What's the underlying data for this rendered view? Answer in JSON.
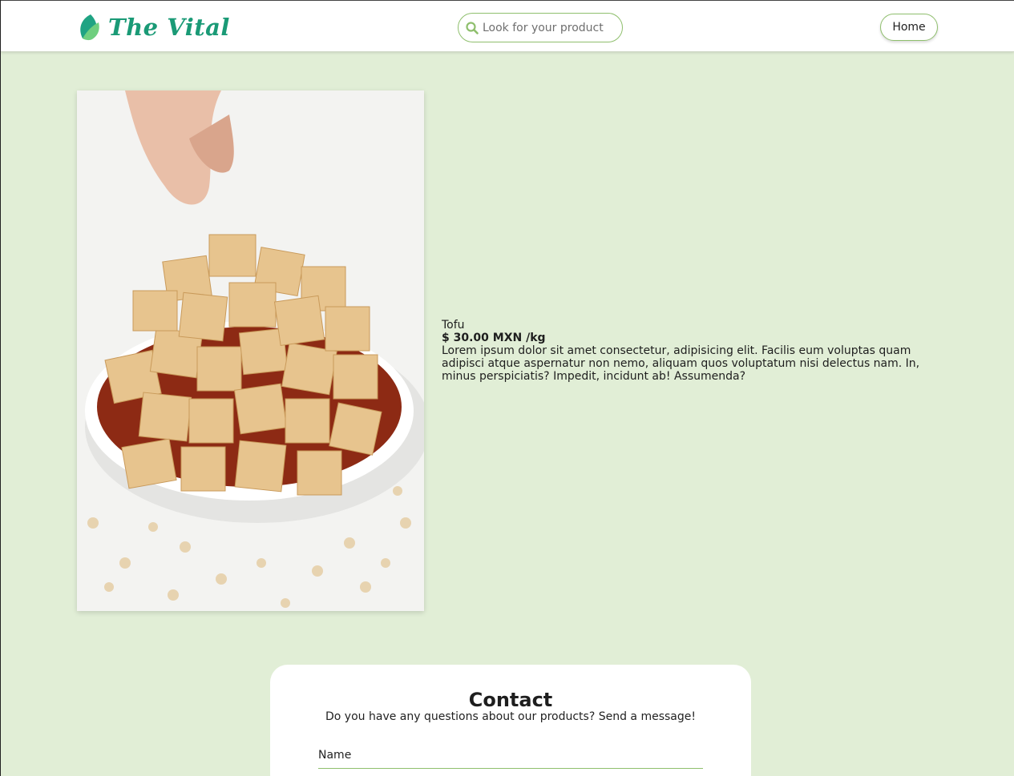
{
  "header": {
    "brand": "The Vital",
    "search": {
      "placeholder": "Look for your product",
      "value": ""
    },
    "home_label": "Home"
  },
  "product": {
    "name": "Tofu",
    "price": "$ 30.00 MXN /kg",
    "description": "Lorem ipsum dolor sit amet consectetur, adipisicing elit. Facilis eum voluptas quam adipisci atque aspernatur non nemo, aliquam quos voluptatum nisi delectus nam. In, minus perspiciatis? Impedit, incidunt ab! Assumenda?"
  },
  "contact": {
    "title": "Contact",
    "subtitle": "Do you have any questions about our products? Send a message!",
    "name_label": "Name"
  },
  "colors": {
    "page_background": "#e1eed6",
    "brand_green": "#1a9a76",
    "accent_green": "#8fbf6d"
  },
  "icons": {
    "logo": "leaf-icon",
    "search": "search-icon"
  }
}
